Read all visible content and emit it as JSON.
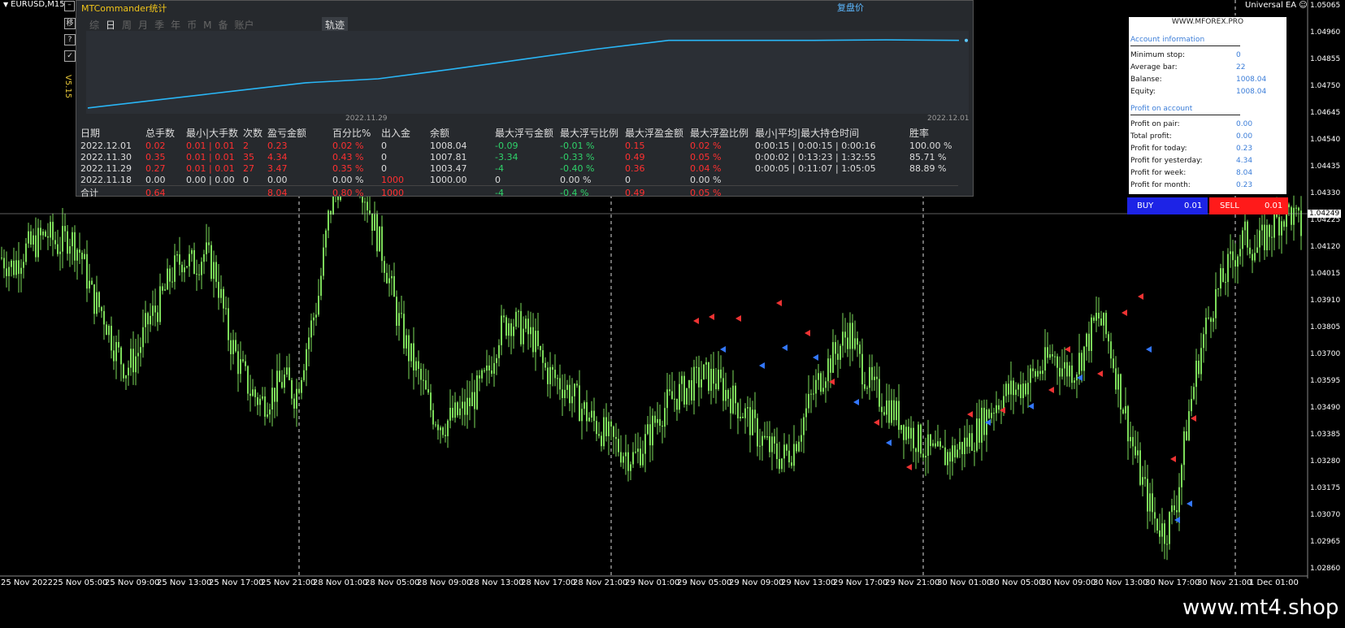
{
  "window": {
    "symbol": "EURUSD,M15"
  },
  "side_buttons": [
    "移",
    "?",
    "✓"
  ],
  "version": "V5.15",
  "panel": {
    "title": "MTCommander统计",
    "replay_label": "复盘价",
    "tabs": [
      "综",
      "日",
      "周",
      "月",
      "季",
      "年",
      "币",
      "M",
      "备",
      "账户"
    ],
    "active_tab": "日",
    "track_tab": "轨迹",
    "curve_date_left": "2022.11.29",
    "curve_date_right": "2022.12.01",
    "curve_color": "#29b6f6",
    "equity_curve": [
      1000.0,
      1001.0,
      1002.0,
      1003.0,
      1003.47,
      1004.6,
      1005.8,
      1007.0,
      1008.04,
      1008.04,
      1008.04,
      1008.1,
      1008.04
    ],
    "headers": [
      "日期",
      "总手数",
      "最小|大手数",
      "次数",
      "盈亏金额",
      "百分比%",
      "出入金",
      "余额",
      "最大浮亏金额",
      "最大浮亏比例",
      "最大浮盈金额",
      "最大浮盈比例",
      "最小|平均|最大持仓时间",
      "胜率"
    ],
    "rows": [
      [
        "2022.12.01",
        "0.02",
        "0.01 | 0.01",
        "2",
        "0.23",
        "0.02 %",
        "0",
        "1008.04",
        "-0.09",
        "-0.01 %",
        "0.15",
        "0.02 %",
        "0:00:15 | 0:00:15 | 0:00:16",
        "100.00 %"
      ],
      [
        "2022.11.30",
        "0.35",
        "0.01 | 0.01",
        "35",
        "4.34",
        "0.43 %",
        "0",
        "1007.81",
        "-3.34",
        "-0.33 %",
        "0.49",
        "0.05 %",
        "0:00:02 | 0:13:23 | 1:32:55",
        "85.71 %"
      ],
      [
        "2022.11.29",
        "0.27",
        "0.01 | 0.01",
        "27",
        "3.47",
        "0.35 %",
        "0",
        "1003.47",
        "-4",
        "-0.40 %",
        "0.36",
        "0.04 %",
        "0:00:05 | 0:11:07 | 1:05:05",
        "88.89 %"
      ],
      [
        "2022.11.18",
        "0.00",
        "0.00 | 0.00",
        "0",
        "0.00",
        "0.00 %",
        "1000",
        "1000.00",
        "0",
        "0.00 %",
        "0",
        "0.00 %",
        "",
        ""
      ]
    ],
    "total": [
      "合计",
      "0.64",
      "",
      "",
      "8.04",
      "0.80 %",
      "1000",
      "",
      "-4",
      "-0.4 %",
      "0.49",
      "0.05 %",
      "",
      ""
    ]
  },
  "account": {
    "site": "WWW.MFOREX.PRO",
    "section_info": "Account information",
    "info": [
      [
        "Minimum stop:",
        "0"
      ],
      [
        "Average bar:",
        "22"
      ],
      [
        "Balanse:",
        "1008.04"
      ],
      [
        "Equity:",
        "1008.04"
      ]
    ],
    "section_profit": "Profit on account",
    "profit": [
      [
        "Profit on pair:",
        "0.00"
      ],
      [
        "Total profit:",
        "0.00"
      ],
      [
        "Profit for today:",
        "0.23"
      ],
      [
        "Profit for yesterday:",
        "4.34"
      ],
      [
        "Profit for week:",
        "8.04"
      ],
      [
        "Profit for month:",
        "0.23"
      ]
    ],
    "buy_label": "BUY",
    "buy_lot": "0.01",
    "sell_label": "SELL",
    "sell_lot": "0.01"
  },
  "ea_label": "Universal EA ☺",
  "price_axis": [
    "1.05065",
    "1.04960",
    "1.04855",
    "1.04750",
    "1.04645",
    "1.04540",
    "1.04435",
    "1.04330",
    "1.04225",
    "1.04120",
    "1.04015",
    "1.03910",
    "1.03805",
    "1.03700",
    "1.03595",
    "1.03490",
    "1.03385",
    "1.03280",
    "1.03175",
    "1.03070",
    "1.02965",
    "1.02860"
  ],
  "current_price": "1.04249",
  "time_axis": [
    "25 Nov 2022",
    "25 Nov 05:00",
    "25 Nov 09:00",
    "25 Nov 13:00",
    "25 Nov 17:00",
    "25 Nov 21:00",
    "28 Nov 01:00",
    "28 Nov 05:00",
    "28 Nov 09:00",
    "28 Nov 13:00",
    "28 Nov 17:00",
    "28 Nov 21:00",
    "29 Nov 01:00",
    "29 Nov 05:00",
    "29 Nov 09:00",
    "29 Nov 13:00",
    "29 Nov 17:00",
    "29 Nov 21:00",
    "30 Nov 01:00",
    "30 Nov 05:00",
    "30 Nov 09:00",
    "30 Nov 13:00",
    "30 Nov 17:00",
    "30 Nov 21:00",
    "1 Dec 01:00"
  ],
  "chart_data": {
    "type": "candlestick",
    "candle_color": "#7cdc5a",
    "y_range": [
      1.0286,
      1.05065
    ],
    "close_path": [
      1.0412,
      1.0408,
      1.0415,
      1.0418,
      1.0422,
      1.0417,
      1.0421,
      1.0414,
      1.0396,
      1.0389,
      1.0375,
      1.0366,
      1.0372,
      1.0386,
      1.0393,
      1.0405,
      1.0412,
      1.0409,
      1.0414,
      1.0405,
      1.0381,
      1.0368,
      1.0357,
      1.0352,
      1.0356,
      1.0362,
      1.0355,
      1.0376,
      1.0395,
      1.0431,
      1.0446,
      1.0452,
      1.0441,
      1.0425,
      1.0409,
      1.0388,
      1.0373,
      1.0362,
      1.0349,
      1.0343,
      1.0346,
      1.0349,
      1.0356,
      1.0363,
      1.0381,
      1.0387,
      1.0382,
      1.0379,
      1.0366,
      1.0362,
      1.0358,
      1.0352,
      1.0346,
      1.0341,
      1.0336,
      1.0332,
      1.0329,
      1.0336,
      1.0346,
      1.0352,
      1.0356,
      1.0359,
      1.0363,
      1.0362,
      1.0357,
      1.0352,
      1.0346,
      1.0338,
      1.0333,
      1.0329,
      1.0333,
      1.0346,
      1.0358,
      1.0367,
      1.0374,
      1.0382,
      1.0368,
      1.0358,
      1.0353,
      1.0348,
      1.0342,
      1.0337,
      1.0332,
      1.0329,
      1.0331,
      1.0334,
      1.0338,
      1.0346,
      1.0352,
      1.0356,
      1.0358,
      1.0362,
      1.0366,
      1.0372,
      1.0366,
      1.0366,
      1.0376,
      1.0388,
      1.0377,
      1.0356,
      1.0336,
      1.0318,
      1.0304,
      1.0298,
      1.0312,
      1.0346,
      1.0372,
      1.0391,
      1.0402,
      1.0412,
      1.0421,
      1.0415,
      1.0422,
      1.0428,
      1.0431,
      1.0424
    ]
  },
  "watermark": "www.mt4.shop"
}
